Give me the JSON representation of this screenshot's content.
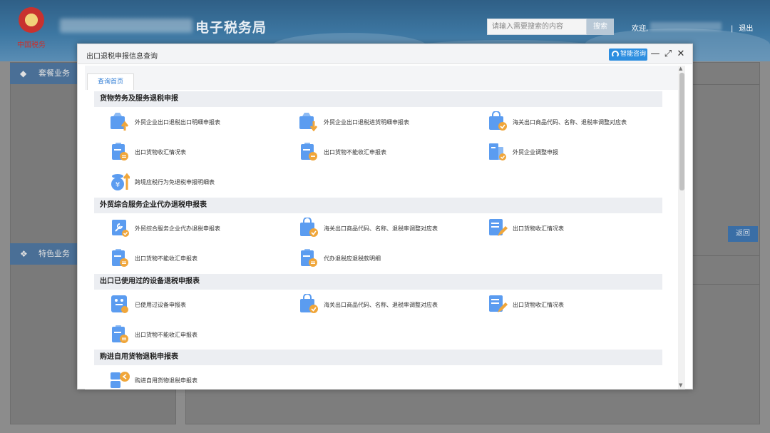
{
  "header": {
    "emblem_text": "中国税务",
    "site_title": "电子税务局",
    "search_placeholder": "请输入需要搜索的内容",
    "search_button": "搜索",
    "welcome": "欢迎,",
    "logout": "退出"
  },
  "background": {
    "left_panel_1": "套餐业务",
    "left_panel_2": "特色业务",
    "return_button": "返回"
  },
  "modal": {
    "title": "出口退税申报信息查询",
    "smart_consult": "智能咨询",
    "minimize_icon": "—",
    "maximize_icon": "⤢",
    "close_icon": "✕",
    "tab": "查询首页",
    "sections": [
      {
        "title": "货物劳务及服务退税申报",
        "items": [
          {
            "label": "外贸企业出口退税出口明细申报表",
            "icon": "upload-bag-icon"
          },
          {
            "label": "外贸企业出口退税进货明细申报表",
            "icon": "download-bag-icon"
          },
          {
            "label": "海关出口商品代码、名称、退税率调整对应表",
            "icon": "shopping-bag-check-icon"
          },
          {
            "label": "出口货物收汇情况表",
            "icon": "clipboard-icon"
          },
          {
            "label": "出口货物不能收汇申报表",
            "icon": "clipboard-minus-icon"
          },
          {
            "label": "外贸企业调整申报",
            "icon": "document-check-icon"
          },
          {
            "label": "跨境应税行为免退税申报明细表",
            "icon": "yuan-coin-arrow-icon"
          }
        ]
      },
      {
        "title": "外贸综合服务企业代办退税申报表",
        "items": [
          {
            "label": "外贸综合服务企业代办退税申报表",
            "icon": "wrench-doc-icon"
          },
          {
            "label": "海关出口商品代码、名称、退税率调整对应表",
            "icon": "shopping-bag-check-icon"
          },
          {
            "label": "出口货物收汇情况表",
            "icon": "edit-doc-icon"
          },
          {
            "label": "出口货物不能收汇申报表",
            "icon": "clipboard-icon"
          },
          {
            "label": "代办退税应退税款明细",
            "icon": "clipboard-icon"
          }
        ]
      },
      {
        "title": "出口已使用过的设备退税申报表",
        "items": [
          {
            "label": "已使用过设备申报表",
            "icon": "equipment-icon"
          },
          {
            "label": "海关出口商品代码、名称、退税率调整对应表",
            "icon": "shopping-bag-check-icon"
          },
          {
            "label": "出口货物收汇情况表",
            "icon": "edit-doc-icon"
          },
          {
            "label": "出口货物不能收汇申报表",
            "icon": "clipboard-icon"
          }
        ]
      },
      {
        "title": "购进自用货物退税申报表",
        "items": [
          {
            "label": "购进自用货物退税申报表",
            "icon": "return-arrow-icon"
          }
        ]
      }
    ]
  },
  "colors": {
    "accent": "#2d8ee0",
    "icon_blue": "#5b9cf0",
    "icon_orange": "#f0a63a"
  }
}
